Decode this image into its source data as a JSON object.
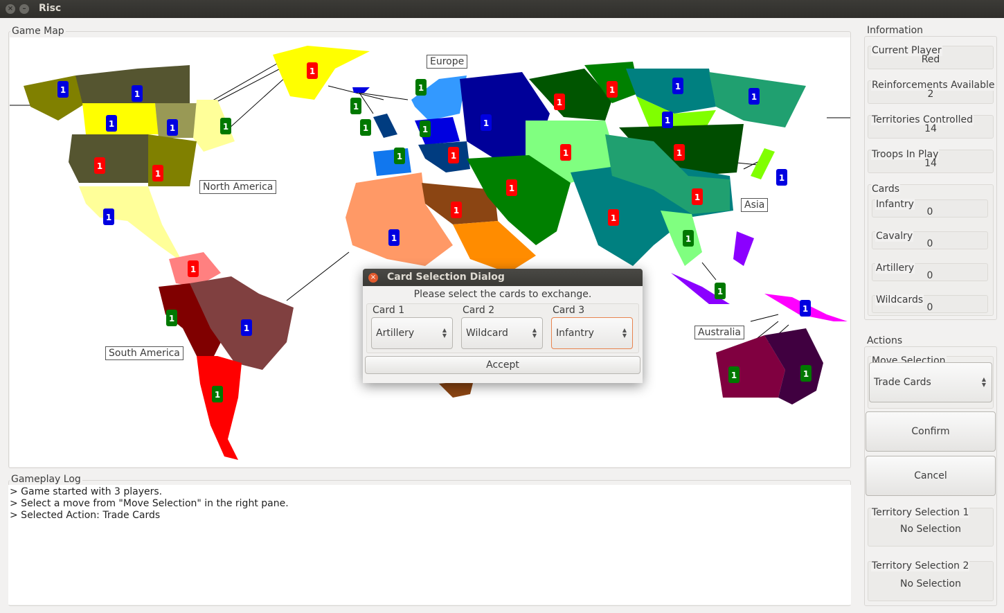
{
  "window": {
    "title": "Risc",
    "close_glyph": "×",
    "min_glyph": "–"
  },
  "map": {
    "group_label": "Game Map",
    "continents": [
      "Europe",
      "North America",
      "Asia",
      "South America",
      "Australia"
    ],
    "colors": {
      "red": "#ff0000",
      "blue": "#0000e0",
      "green": "#007800"
    }
  },
  "log": {
    "group_label": "Gameplay Log",
    "lines": [
      "> Game started with 3 players.",
      "> Select a move from \"Move Selection\" in the right pane.",
      "> Selected Action: Trade Cards"
    ]
  },
  "information": {
    "group_label": "Information",
    "current_player_label": "Current Player",
    "current_player": "Red",
    "reinforcements_label": "Reinforcements Available",
    "reinforcements": "2",
    "territories_label": "Territories Controlled",
    "territories": "14",
    "troops_label": "Troops In Play",
    "troops": "14",
    "cards_label": "Cards",
    "cards": [
      {
        "label": "Infantry",
        "count": "0"
      },
      {
        "label": "Cavalry",
        "count": "0"
      },
      {
        "label": "Artillery",
        "count": "0"
      },
      {
        "label": "Wildcards",
        "count": "0"
      }
    ]
  },
  "actions": {
    "group_label": "Actions",
    "move_selection_label": "Move Selection",
    "move_selection_value": "Trade Cards",
    "confirm_label": "Confirm",
    "cancel_label": "Cancel",
    "territory1_label": "Territory Selection 1",
    "territory1_value": "No Selection",
    "territory2_label": "Territory Selection 2",
    "territory2_value": "No Selection"
  },
  "dialog": {
    "title": "Card Selection Dialog",
    "prompt": "Please select the cards to exchange.",
    "card1_label": "Card 1",
    "card1_value": "Artillery",
    "card2_label": "Card 2",
    "card2_value": "Wildcard",
    "card3_label": "Card 3",
    "card3_value": "Infantry",
    "accept_label": "Accept"
  }
}
